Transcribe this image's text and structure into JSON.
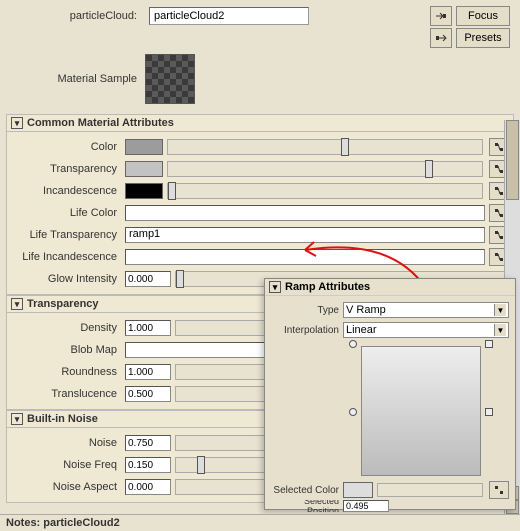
{
  "header": {
    "name_label": "particleCloud:",
    "name_value": "particleCloud2",
    "focus_btn": "Focus",
    "presets_btn": "Presets"
  },
  "sample": {
    "label": "Material Sample"
  },
  "sections": {
    "common": {
      "title": "Common Material Attributes",
      "color_label": "Color",
      "color_value": "#9c9c9c",
      "transparency_label": "Transparency",
      "transparency_value": "#c2c2c2",
      "incandescence_label": "Incandescence",
      "incandescence_value": "#000000",
      "life_color_label": "Life Color",
      "life_transparency_label": "Life Transparency",
      "life_transparency_value": "ramp1",
      "life_incandescence_label": "Life Incandescence",
      "glow_intensity_label": "Glow Intensity",
      "glow_intensity_value": "0.000"
    },
    "transparency": {
      "title": "Transparency",
      "density_label": "Density",
      "density_value": "1.000",
      "blob_map_label": "Blob Map",
      "roundness_label": "Roundness",
      "roundness_value": "1.000",
      "translucence_label": "Translucence",
      "translucence_value": "0.500"
    },
    "noise": {
      "title": "Built-in Noise",
      "noise_label": "Noise",
      "noise_value": "0.750",
      "noise_freq_label": "Noise Freq",
      "noise_freq_value": "0.150",
      "noise_aspect_label": "Noise Aspect",
      "noise_aspect_value": "0.000"
    }
  },
  "popup": {
    "title": "Ramp Attributes",
    "type_label": "Type",
    "type_value": "V Ramp",
    "interp_label": "Interpolation",
    "interp_value": "Linear",
    "selected_color_label": "Selected Color",
    "selected_position_label": "Selected Position",
    "selected_position_value": "0.495"
  },
  "notes": {
    "label": "Notes: particleCloud2"
  },
  "icons": {
    "map_in": "→▪",
    "map_out": "▪→"
  }
}
